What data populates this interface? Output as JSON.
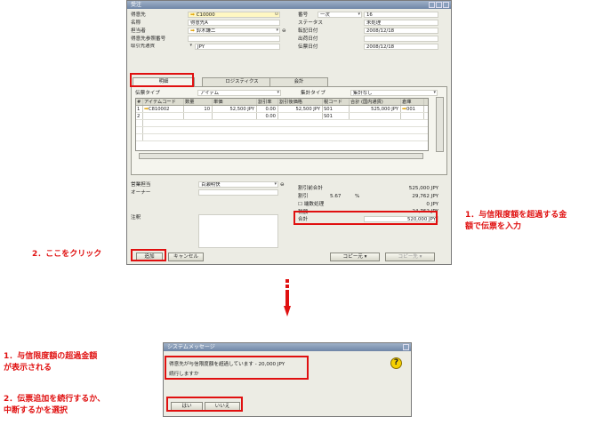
{
  "window": {
    "title": "受注",
    "labels": {
      "customer": "得意先",
      "name": "名称",
      "contact": "担当者",
      "customer_ref": "得意先参照番号",
      "currency": "取引先通貨",
      "number": "番号",
      "status": "ステータス",
      "posting_date": "転記日付",
      "delivery_date": "出荷日付",
      "doc_date": "伝票日付"
    },
    "values": {
      "customer": "C10000",
      "name": "得意先A",
      "contact": "鈴木謙二",
      "customer_ref": "",
      "currency_type": "取引先通貨",
      "currency": "JPY",
      "number_series": "一次",
      "number": "16",
      "status": "未処理",
      "posting_date": "2008/12/18",
      "delivery_date": "",
      "doc_date": "2008/12/18"
    },
    "tabs": [
      "明細",
      "ロジスティクス",
      "会計"
    ],
    "item_type_label": "伝票タイプ",
    "item_type_value": "アイテム",
    "summary_type_label": "集計タイプ",
    "summary_type_value": "集計なし",
    "grid": {
      "headers": [
        "#",
        "アイテムコード",
        "数量",
        "単価",
        "割引率",
        "割引後価格",
        "税コード",
        "合計 (国内通貨)",
        "倉庫"
      ],
      "rows": [
        [
          "1",
          "C810002",
          "10",
          "52,500 JPY",
          "0.00",
          "52,500 JPY",
          "S01",
          "525,000 JPY",
          "001"
        ],
        [
          "2",
          "",
          "",
          "",
          "0.00",
          "",
          "S01",
          "",
          ""
        ]
      ]
    },
    "footer": {
      "sales_employee_label": "営業担当",
      "sales_employee": "百瀬明快",
      "owner_label": "オーナー",
      "remarks_label": "注釈",
      "before_discount_label": "割引前合計",
      "before_discount": "525,000 JPY",
      "discount_label": "割引",
      "discount_pct": "5.67",
      "discount_value": "29,762 JPY",
      "rounding_label": "端数処理",
      "rounding_value": "0 JPY",
      "tax_label": "税額",
      "tax_value": "24,762 JPY",
      "total_label": "合計",
      "total_value": "520,000 JPY"
    },
    "buttons": {
      "add": "追加",
      "cancel": "キャンセル",
      "copy_from": "コピー元",
      "copy_to": "コピー先"
    }
  },
  "dialog": {
    "title": "システムメッセージ",
    "message1": "得意先が与信限度額を超過しています - 20,000 JPY",
    "message2": "続行しますか",
    "yes": "はい",
    "no": "いいえ"
  },
  "notes": {
    "n1a": "1．与信限度額を超過する金",
    "n1b": "額で伝票を入力",
    "n2": "2．ここをクリック",
    "n3a": "1．与信限度額の超過金額",
    "n3b": "が表示される",
    "n4a": "2．伝票追加を続行するか、",
    "n4b": "中断するかを選択"
  },
  "colors": {
    "accent": "#e01010",
    "title_bar": "#6f86a6"
  }
}
